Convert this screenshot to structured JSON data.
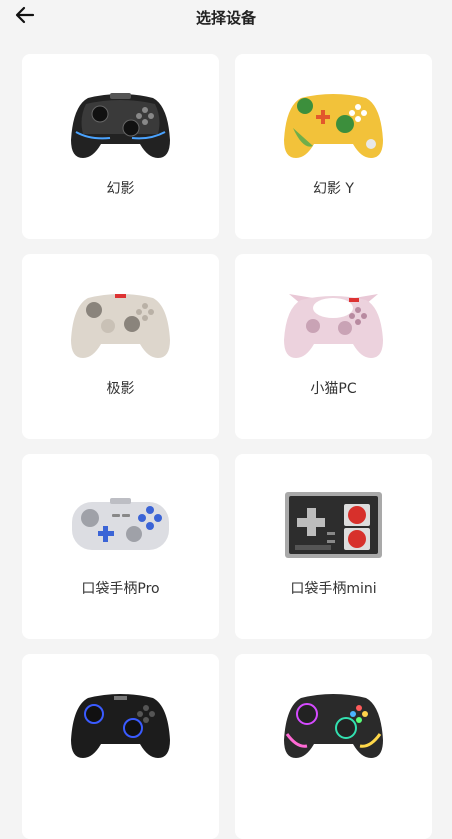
{
  "header": {
    "title": "选择设备",
    "back_icon": "arrow-left-icon"
  },
  "devices": [
    {
      "name": "幻影",
      "image": "black-transparent-gamepad-image"
    },
    {
      "name": "幻影 Y",
      "image": "yellow-green-gamepad-image"
    },
    {
      "name": "极影",
      "image": "beige-gamepad-image"
    },
    {
      "name": "小猫PC",
      "image": "pink-cat-gamepad-image"
    },
    {
      "name": "口袋手柄Pro",
      "image": "grey-pocket-gamepad-image"
    },
    {
      "name": "口袋手柄mini",
      "image": "retro-nes-gamepad-image"
    },
    {
      "name": "",
      "image": "black-blue-ring-gamepad-image"
    },
    {
      "name": "",
      "image": "rgb-transparent-gamepad-image"
    }
  ]
}
